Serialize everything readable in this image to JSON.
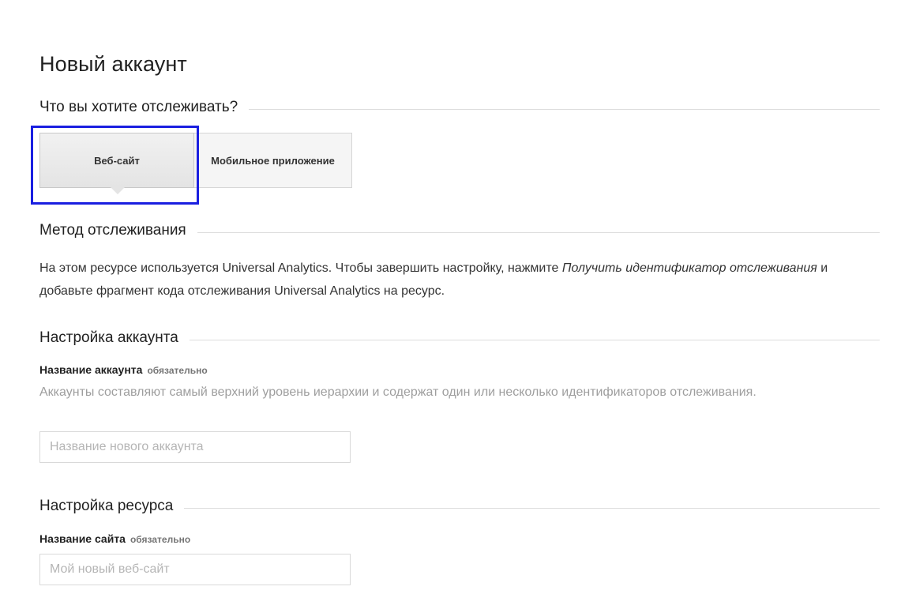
{
  "page": {
    "title": "Новый аккаунт"
  },
  "sections": {
    "track_what": "Что вы хотите отслеживать?",
    "tracking_method": "Метод отслеживания",
    "account_setup": "Настройка аккаунта",
    "property_setup": "Настройка ресурса"
  },
  "tracking_type": {
    "selected": "Веб-сайт",
    "options": [
      "Веб-сайт",
      "Мобильное приложение"
    ]
  },
  "method": {
    "text_before": "На этом ресурсе используется Universal Analytics. Чтобы завершить настройку, нажмите ",
    "emphasis": "Получить идентификатор отслеживания",
    "text_after": " и добавьте фрагмент кода отслеживания Universal Analytics на ресурс."
  },
  "account_name": {
    "label": "Название аккаунта",
    "required": "обязательно",
    "help": "Аккаунты составляют самый верхний уровень иерархии и содержат один или несколько идентификаторов отслеживания.",
    "placeholder": "Название нового аккаунта",
    "value": ""
  },
  "site_name": {
    "label": "Название сайта",
    "required": "обязательно",
    "placeholder": "Мой новый веб-сайт",
    "value": ""
  },
  "colors": {
    "highlight": "#1a1fe0",
    "divider": "#dddddd",
    "help_text": "#9e9e9e"
  }
}
